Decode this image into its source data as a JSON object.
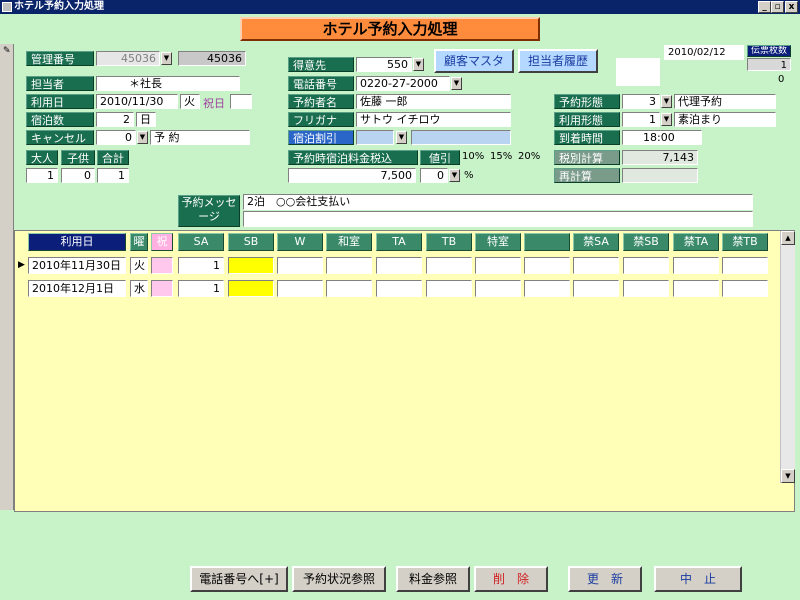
{
  "window": {
    "title": "ホテル予約入力処理",
    "min": "_",
    "restore": "▫",
    "close": "x"
  },
  "form_title": "ホテル予約入力処理",
  "record_marker": "✎",
  "header": {
    "reservation_no_label": "管理番号",
    "reservation_no_value": "45036",
    "reservation_no_display": "45036",
    "customer_label": "得意先",
    "customer_value": "550",
    "customer_master_button": "顧客マスタ",
    "staff_history_button": "担当者履歴",
    "date": "2010/02/12",
    "slip_count_label": "伝票枚数",
    "slip_count_value": "1",
    "slip_count_small": "0"
  },
  "left": {
    "staff_label": "担当者",
    "staff_value": "＊社長",
    "use_date_label": "利用日",
    "use_date_value": "2010/11/30",
    "weekday": "火",
    "holiday_label": "祝日",
    "nights_label": "宿泊数",
    "nights_value": "2",
    "nights_unit": "日",
    "cancel_label": "キャンセル",
    "cancel_value": "0",
    "cancel_text": "予 約",
    "adult_label": "大人",
    "child_label": "子供",
    "total_label": "合計",
    "adult_value": "1",
    "child_value": "0",
    "total_value": "1"
  },
  "middle": {
    "phone_label": "電話番号",
    "phone_value": "0220-27-2000",
    "name_label": "予約者名",
    "name_value": "佐藤 一郎",
    "kana_label": "フリガナ",
    "kana_value": "サトウ イチロウ",
    "discount_label": "宿泊割引",
    "discount_value": "",
    "rate_label": "予約時宿泊料金税込",
    "rate_value": "7,500",
    "reduce_label": "値引",
    "reduce_value": "0",
    "reduce_unit": "%",
    "pct_options": [
      "10%",
      "15%",
      "20%"
    ]
  },
  "right": {
    "type_label": "予約形態",
    "type_code": "3",
    "type_value": "代理予約",
    "usage_label": "利用形態",
    "usage_code": "1",
    "usage_value": "素泊まり",
    "arrival_label": "到着時間",
    "arrival_value": "18:00",
    "tax_label": "税別計算",
    "tax_value": "7,143",
    "recalc_label": "再計算",
    "recalc_value": ""
  },
  "message": {
    "label": "予約メッセージ",
    "line1": "2泊　○○会社支払い",
    "line2": ""
  },
  "grid": {
    "headers": [
      "利用日",
      "曜",
      "祝",
      "SA",
      "SB",
      "W",
      "和室",
      "TA",
      "TB",
      "特室",
      "",
      "禁SA",
      "禁SB",
      "禁TA",
      "禁TB"
    ],
    "rows": [
      {
        "date": "2010年11月30日",
        "dow": "火",
        "holiday": "",
        "SA": "1",
        "SB": "",
        "W": "",
        "washitsu": "",
        "TA": "",
        "TB": "",
        "special": "",
        "blank": "",
        "kSA": "",
        "kSB": "",
        "kTA": "",
        "kTB": ""
      },
      {
        "date": "2010年12月1日",
        "dow": "水",
        "holiday": "",
        "SA": "1",
        "SB": "",
        "W": "",
        "washitsu": "",
        "TA": "",
        "TB": "",
        "special": "",
        "blank": "",
        "kSA": "",
        "kSB": "",
        "kTA": "",
        "kTB": ""
      }
    ]
  },
  "footer": {
    "phone_button": "電話番号へ[+]",
    "status_button": "予約状況参照",
    "rate_button": "料金参照",
    "delete_button": "削　除",
    "update_button": "更　新",
    "cancel_button": "中　止"
  },
  "colors": {
    "form_bg": "#c8f2c8",
    "label_bg": "#1a6e50",
    "title_bg": "#ff8c3c",
    "grid_bg": "#ffffb8"
  }
}
